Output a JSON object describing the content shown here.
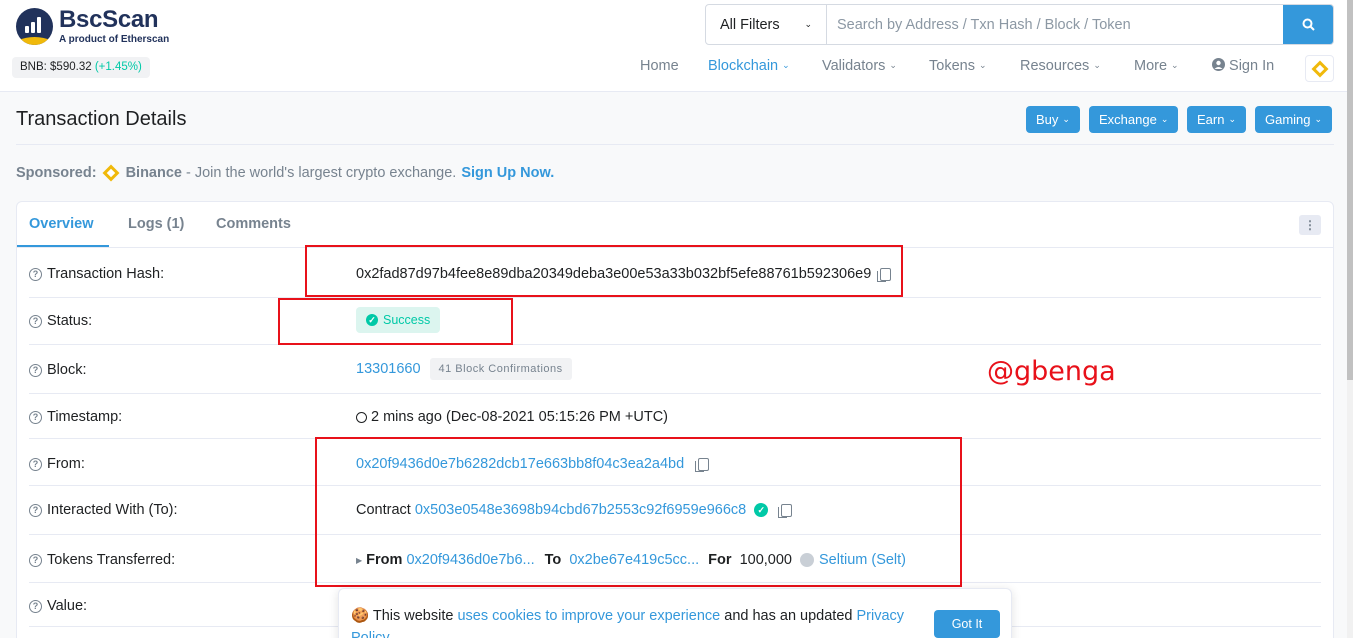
{
  "header": {
    "logo_title": "BscScan",
    "logo_subtitle": "A product of Etherscan",
    "price_label": "BNB: $590.32",
    "price_change": "(+1.45%)",
    "filter_label": "All Filters",
    "search_placeholder": "Search by Address / Txn Hash / Block / Token",
    "search_icon": "search-icon",
    "nav": [
      {
        "label": "Home",
        "active": false
      },
      {
        "label": "Blockchain",
        "active": true
      },
      {
        "label": "Validators",
        "active": false
      },
      {
        "label": "Tokens",
        "active": false
      },
      {
        "label": "Resources",
        "active": false
      },
      {
        "label": "More",
        "active": false
      }
    ],
    "sign_in": "Sign In"
  },
  "page": {
    "title": "Transaction Details",
    "buttons": [
      "Buy",
      "Exchange",
      "Earn",
      "Gaming"
    ]
  },
  "sponsor": {
    "label": "Sponsored:",
    "name": "Binance",
    "text": "- Join the world's largest crypto exchange.",
    "cta": "Sign Up Now."
  },
  "tabs": [
    "Overview",
    "Logs (1)",
    "Comments"
  ],
  "details": {
    "tx_hash_label": "Transaction Hash:",
    "tx_hash": "0x2fad87d97b4fee8e89dba20349deba3e00e53a33b032bf5efe88761b592306e9",
    "status_label": "Status:",
    "status": "Success",
    "block_label": "Block:",
    "block": "13301660",
    "confirmations": "41 Block Confirmations",
    "timestamp_label": "Timestamp:",
    "timestamp": "2 mins ago (Dec-08-2021 05:15:26 PM +UTC)",
    "from_label": "From:",
    "from": "0x20f9436d0e7b6282dcb17e663bb8f04c3ea2a4bd",
    "to_label": "Interacted With (To):",
    "to_prefix": "Contract",
    "to": "0x503e0548e3698b94cbd67b2553c92f6959e966c8",
    "tokens_label": "Tokens Transferred:",
    "tokens_from_kw": "From",
    "tokens_from": "0x20f9436d0e7b6...",
    "tokens_to_kw": "To",
    "tokens_to": "0x2be67e419c5cc...",
    "tokens_for_kw": "For",
    "tokens_amount": "100,000",
    "token_name": "Seltium (Selt)",
    "value_label": "Value:"
  },
  "watermark": "@gbenga",
  "cookie": {
    "text1": "This website",
    "link1": "uses cookies to improve your experience",
    "text2": "and has an updated",
    "link2": "Privacy Policy.",
    "button": "Got It"
  },
  "colors": {
    "accent": "#3498db",
    "success": "#00c9a7",
    "annotation": "#e8111a",
    "brand": "#21325b",
    "bnb": "#f0b90b"
  }
}
